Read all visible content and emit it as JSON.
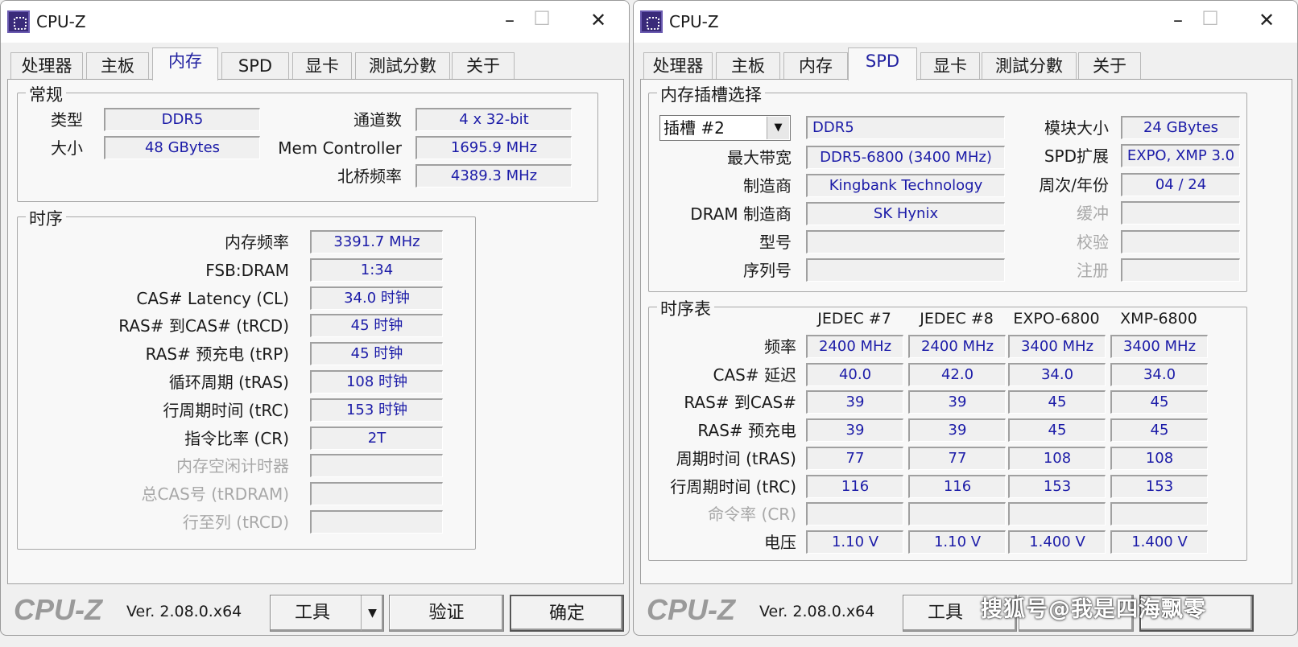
{
  "windows": [
    {
      "title": "CPU-Z",
      "tabs": [
        "处理器",
        "主板",
        "内存",
        "SPD",
        "显卡",
        "測試分數",
        "关于"
      ],
      "active_tab": "内存",
      "footer": {
        "logo": "CPU-Z",
        "version": "Ver. 2.08.0.x64",
        "tools": "工具",
        "validate": "验证",
        "ok": "确定"
      }
    },
    {
      "title": "CPU-Z",
      "tabs": [
        "处理器",
        "主板",
        "内存",
        "SPD",
        "显卡",
        "測試分數",
        "关于"
      ],
      "active_tab": "SPD",
      "footer": {
        "logo": "CPU-Z",
        "version": "Ver. 2.08.0.x64",
        "tools": "工具"
      }
    }
  ],
  "memory": {
    "general": {
      "title": "常规",
      "type_label": "类型",
      "type": "DDR5",
      "size_label": "大小",
      "size": "48 GBytes",
      "channels_label": "通道数",
      "channels": "4 x 32-bit",
      "mc_label": "Mem Controller",
      "mc": "1695.9 MHz",
      "nb_label": "北桥频率",
      "nb": "4389.3 MHz"
    },
    "timings": {
      "title": "时序",
      "rows": [
        {
          "label": "内存频率",
          "value": "3391.7 MHz"
        },
        {
          "label": "FSB:DRAM",
          "value": "1:34"
        },
        {
          "label": "CAS# Latency (CL)",
          "value": "34.0 时钟"
        },
        {
          "label": "RAS# 到CAS# (tRCD)",
          "value": "45 时钟"
        },
        {
          "label": "RAS# 预充电 (tRP)",
          "value": "45 时钟"
        },
        {
          "label": "循环周期 (tRAS)",
          "value": "108 时钟"
        },
        {
          "label": "行周期时间 (tRC)",
          "value": "153 时钟"
        },
        {
          "label": "指令比率 (CR)",
          "value": "2T"
        },
        {
          "label": "内存空闲计时器",
          "value": "",
          "disabled": true
        },
        {
          "label": "总CAS号 (tRDRAM)",
          "value": "",
          "disabled": true
        },
        {
          "label": "行至列 (tRCD)",
          "value": "",
          "disabled": true
        }
      ]
    }
  },
  "spd": {
    "slot": {
      "title": "内存插槽选择",
      "selected": "插槽 #2",
      "type": "DDR5",
      "rows": [
        {
          "label": "最大带宽",
          "value": "DDR5-6800 (3400 MHz)"
        },
        {
          "label": "制造商",
          "value": "Kingbank Technology"
        },
        {
          "label": "DRAM 制造商",
          "value": "SK Hynix"
        },
        {
          "label": "型号",
          "value": ""
        },
        {
          "label": "序列号",
          "value": ""
        }
      ],
      "right": [
        {
          "label": "模块大小",
          "value": "24 GBytes"
        },
        {
          "label": "SPD扩展",
          "value": "EXPO, XMP 3.0"
        },
        {
          "label": "周次/年份",
          "value": "04 / 24"
        },
        {
          "label": "缓冲",
          "value": "",
          "disabled": true
        },
        {
          "label": "校验",
          "value": "",
          "disabled": true
        },
        {
          "label": "注册",
          "value": "",
          "disabled": true
        }
      ]
    },
    "table": {
      "title": "时序表",
      "columns": [
        "JEDEC #7",
        "JEDEC #8",
        "EXPO-6800",
        "XMP-6800"
      ],
      "rows": [
        {
          "label": "频率",
          "values": [
            "2400 MHz",
            "2400 MHz",
            "3400 MHz",
            "3400 MHz"
          ]
        },
        {
          "label": "CAS# 延迟",
          "values": [
            "40.0",
            "42.0",
            "34.0",
            "34.0"
          ]
        },
        {
          "label": "RAS# 到CAS#",
          "values": [
            "39",
            "39",
            "45",
            "45"
          ]
        },
        {
          "label": "RAS# 预充电",
          "values": [
            "39",
            "39",
            "45",
            "45"
          ]
        },
        {
          "label": "周期时间 (tRAS)",
          "values": [
            "77",
            "77",
            "108",
            "108"
          ]
        },
        {
          "label": "行周期时间 (tRC)",
          "values": [
            "116",
            "116",
            "153",
            "153"
          ]
        },
        {
          "label": "命令率 (CR)",
          "values": [
            "",
            "",
            "",
            ""
          ],
          "disabled": true
        },
        {
          "label": "电压",
          "values": [
            "1.10 V",
            "1.10 V",
            "1.400 V",
            "1.400 V"
          ]
        }
      ]
    }
  },
  "watermark": "搜狐号@我是四海飘零"
}
